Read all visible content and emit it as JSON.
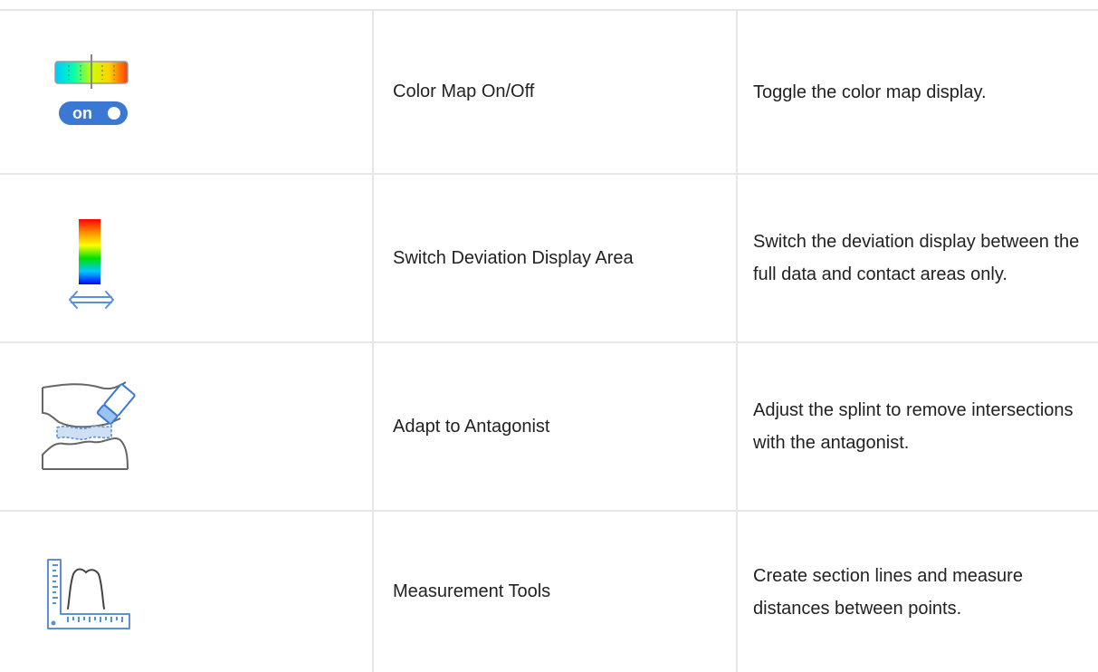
{
  "tools": [
    {
      "icon": "color-map-toggle-icon",
      "name": "Color Map On/Off",
      "description": "Toggle the color map display.",
      "toggle_label": "on"
    },
    {
      "icon": "deviation-area-switch-icon",
      "name": "Switch Deviation Display Area",
      "description": "Switch the deviation display between the full data and contact areas only."
    },
    {
      "icon": "adapt-antagonist-icon",
      "name": "Adapt to Antagonist",
      "description": "Adjust the splint to remove intersections with the antagonist."
    },
    {
      "icon": "measurement-tools-icon",
      "name": "Measurement Tools",
      "description": "Create section lines and measure distances between points."
    }
  ],
  "colors": {
    "accent_blue": "#3a78d4",
    "icon_line_blue": "#5b8fd6",
    "grid_line": "#e6e6e6",
    "text": "#222222"
  }
}
